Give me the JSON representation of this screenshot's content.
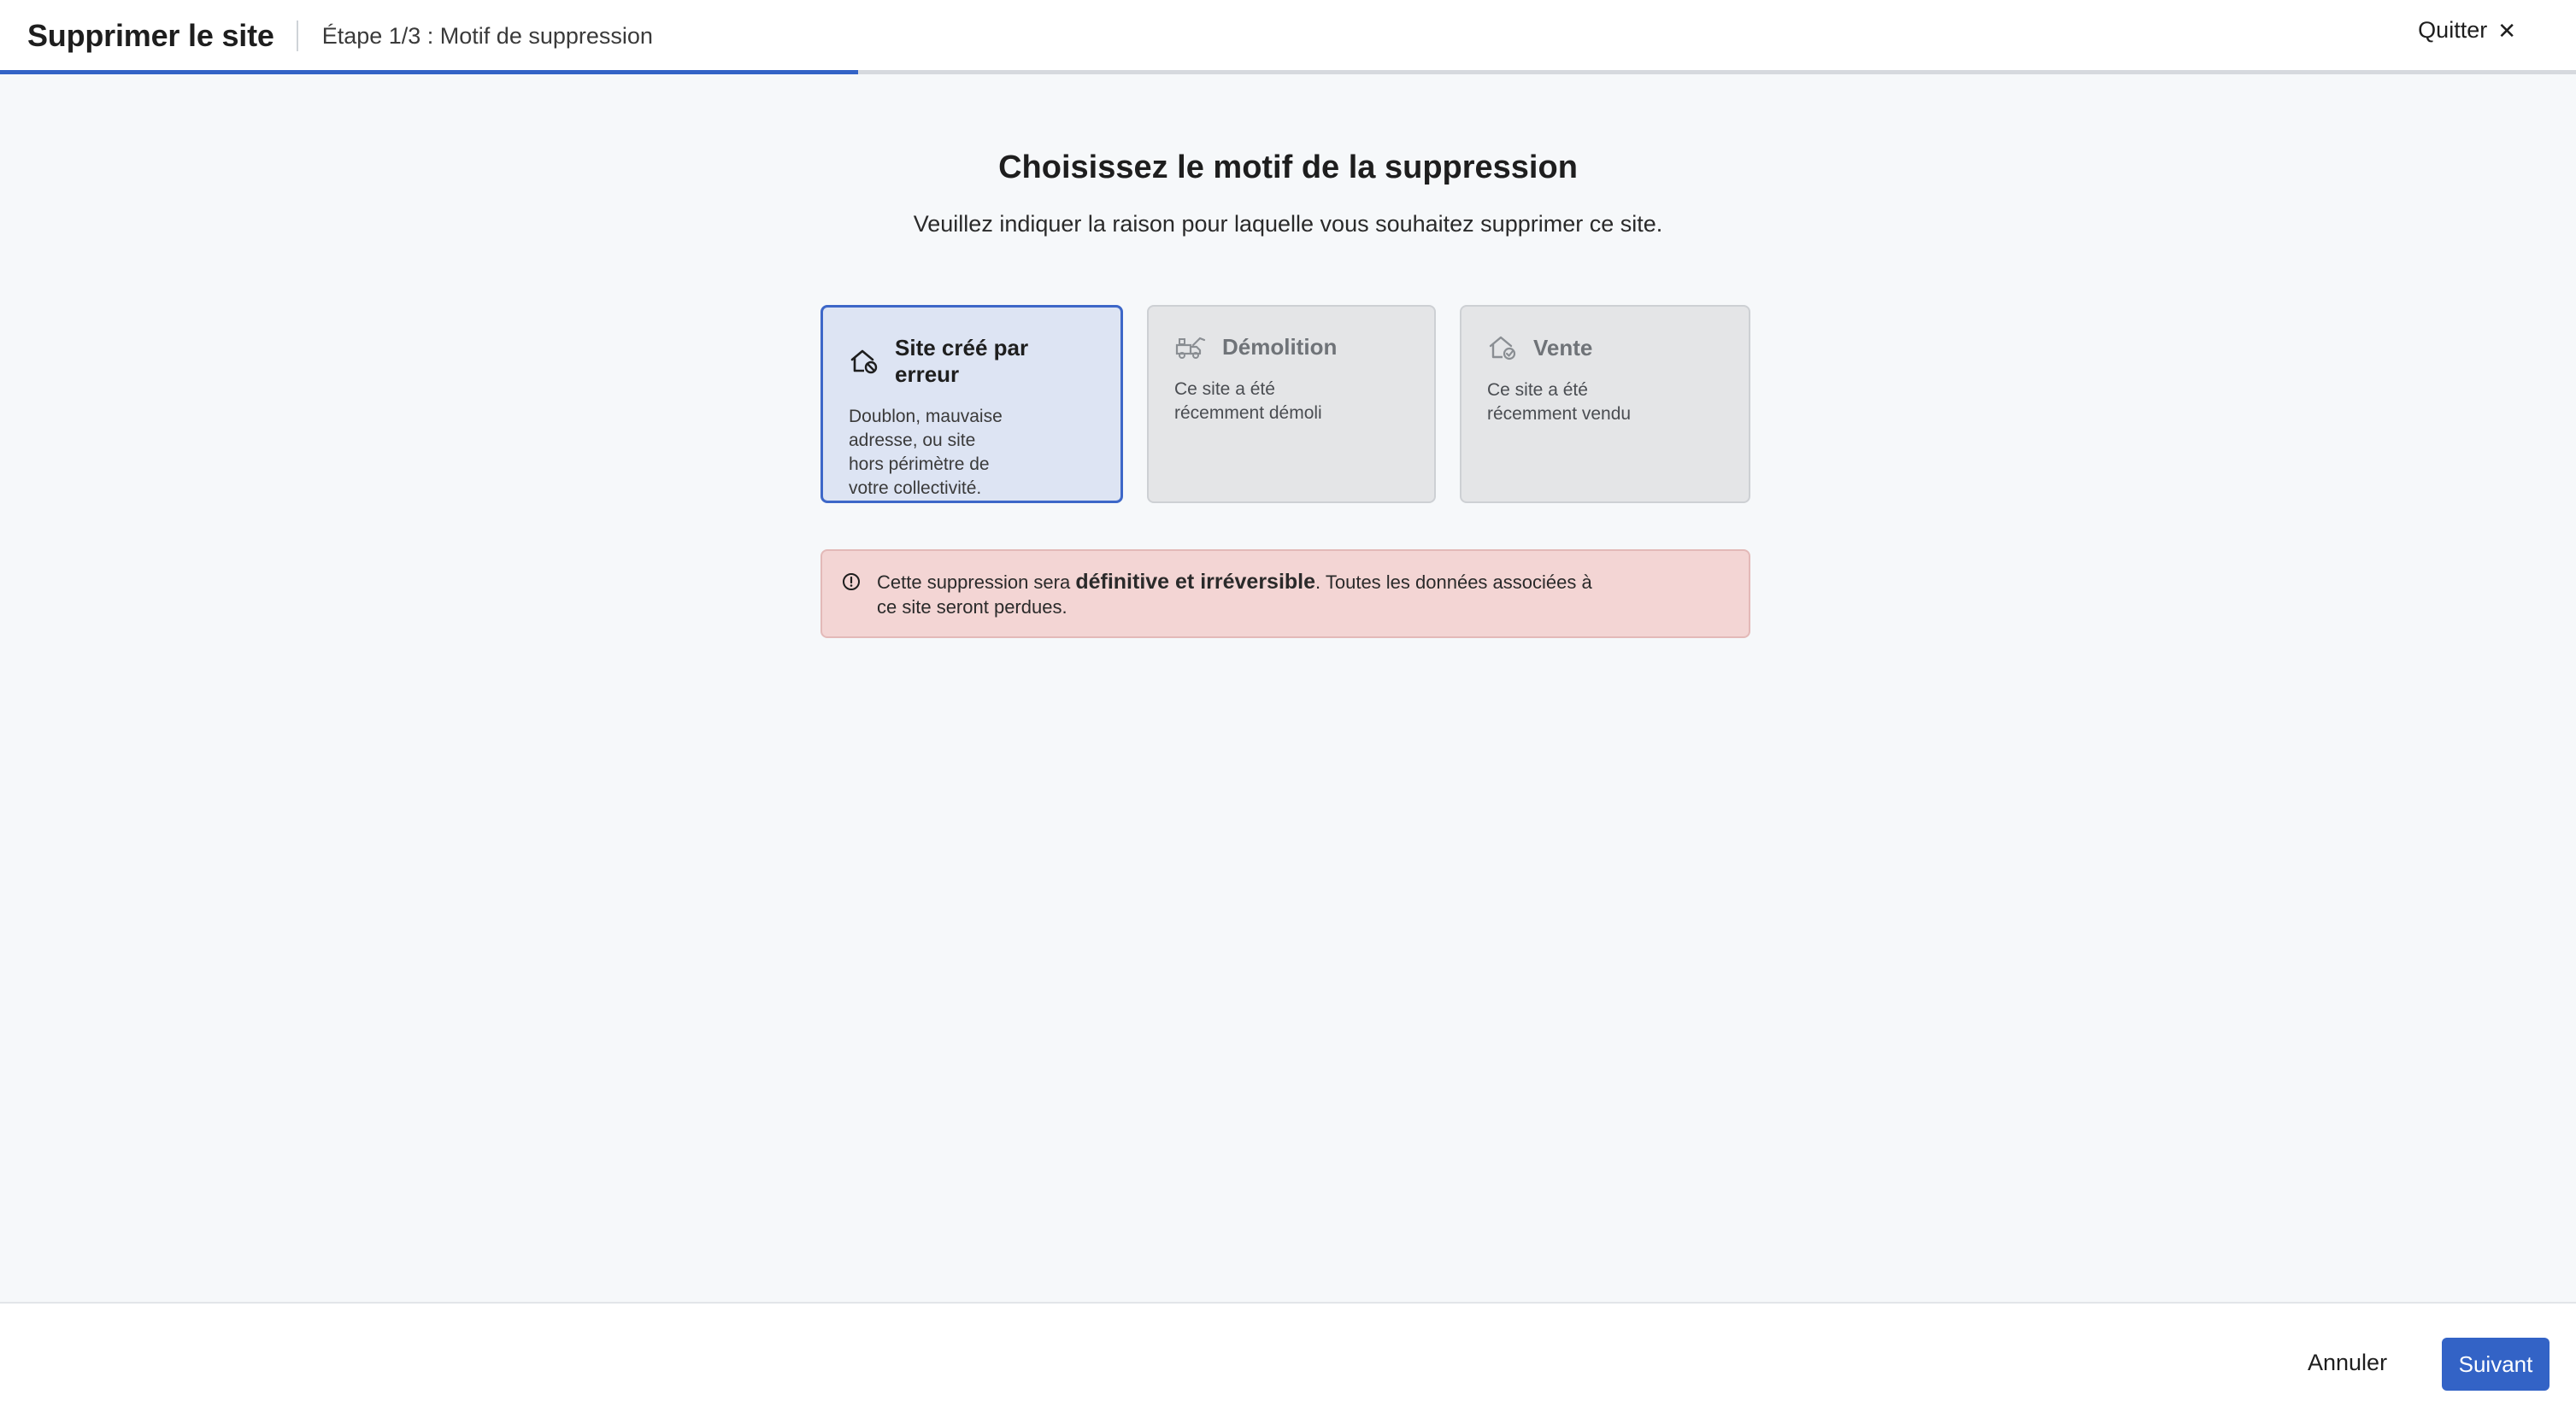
{
  "header": {
    "title": "Supprimer le site",
    "step": "Étape 1/3 : Motif de suppression",
    "quit_label": "Quitter",
    "quit_icon": "close-icon"
  },
  "progress": {
    "fraction": 0.333
  },
  "main": {
    "heading": "Choisissez le motif de la suppression",
    "subheading": "Veuillez indiquer la raison pour laquelle vous souhaitez supprimer ce site.",
    "options": [
      {
        "title": "Site créé par erreur",
        "description": "Doublon, mauvaise\nadresse, ou site\nhors périmètre de\nvotre collectivité.",
        "icon": "house-error-icon",
        "state": "selected"
      },
      {
        "title": "Démolition",
        "description": "Ce site a été\nrécemment démoli",
        "icon": "demolition-truck-icon",
        "state": "disabled"
      },
      {
        "title": "Vente",
        "description": "Ce site a été\nrécemment vendu",
        "icon": "house-sold-icon",
        "state": "disabled"
      }
    ],
    "alert": {
      "icon": "info-circle-icon",
      "text_before": "Cette suppression sera ",
      "text_bold": "définitive et irréversible",
      "text_after": ". Toutes les données associées à ce site seront perdues."
    }
  },
  "footer": {
    "cancel_label": "Annuler",
    "next_label": "Suivant"
  },
  "colors": {
    "accent": "#3363c6",
    "selected_card_bg": "#dde4f3",
    "alert_bg": "#f3d5d4"
  }
}
